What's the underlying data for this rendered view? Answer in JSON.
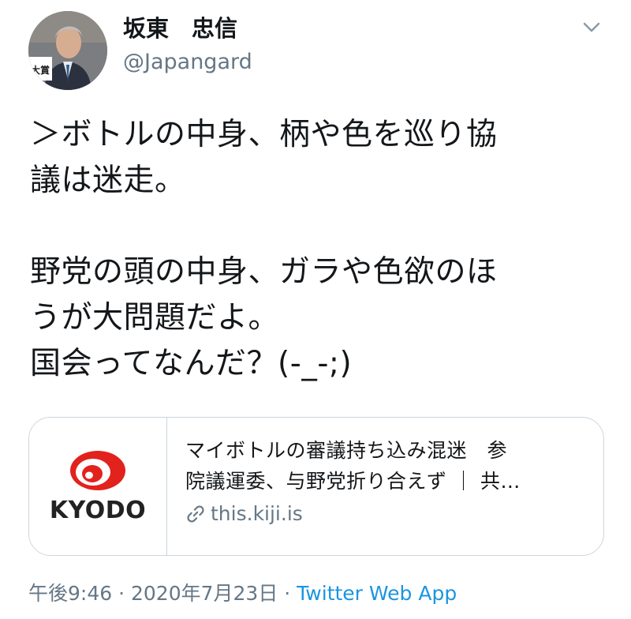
{
  "author": {
    "display_name": "坂東　忠信",
    "handle": "@Japangard",
    "avatar_badge": "大賞"
  },
  "tweet": {
    "text": "＞ボトルの中身、柄や色を巡り協\n議は迷走。\n\n野党の頭の中身、ガラや色欲のほ\nうが大問題だよ。\n国会ってなんだ？(-_-;)"
  },
  "card": {
    "brand": "KYODO",
    "title": "マイボトルの審議持ち込み混迷　参\n院議運委、与野党折り合えず ｜ 共…",
    "domain": "this.kiji.is"
  },
  "footer": {
    "time": "午後9:46",
    "separator_1": " · ",
    "date": "2020年7月23日",
    "separator_2": " · ",
    "source": "Twitter Web App"
  },
  "icons": {
    "caret": "chevron-down-icon",
    "link": "link-icon"
  },
  "colors": {
    "text": "#14171a",
    "secondary": "#657786",
    "link": "#1b95e0",
    "border": "#ccd6dd",
    "kyodo_red": "#e2221c"
  }
}
